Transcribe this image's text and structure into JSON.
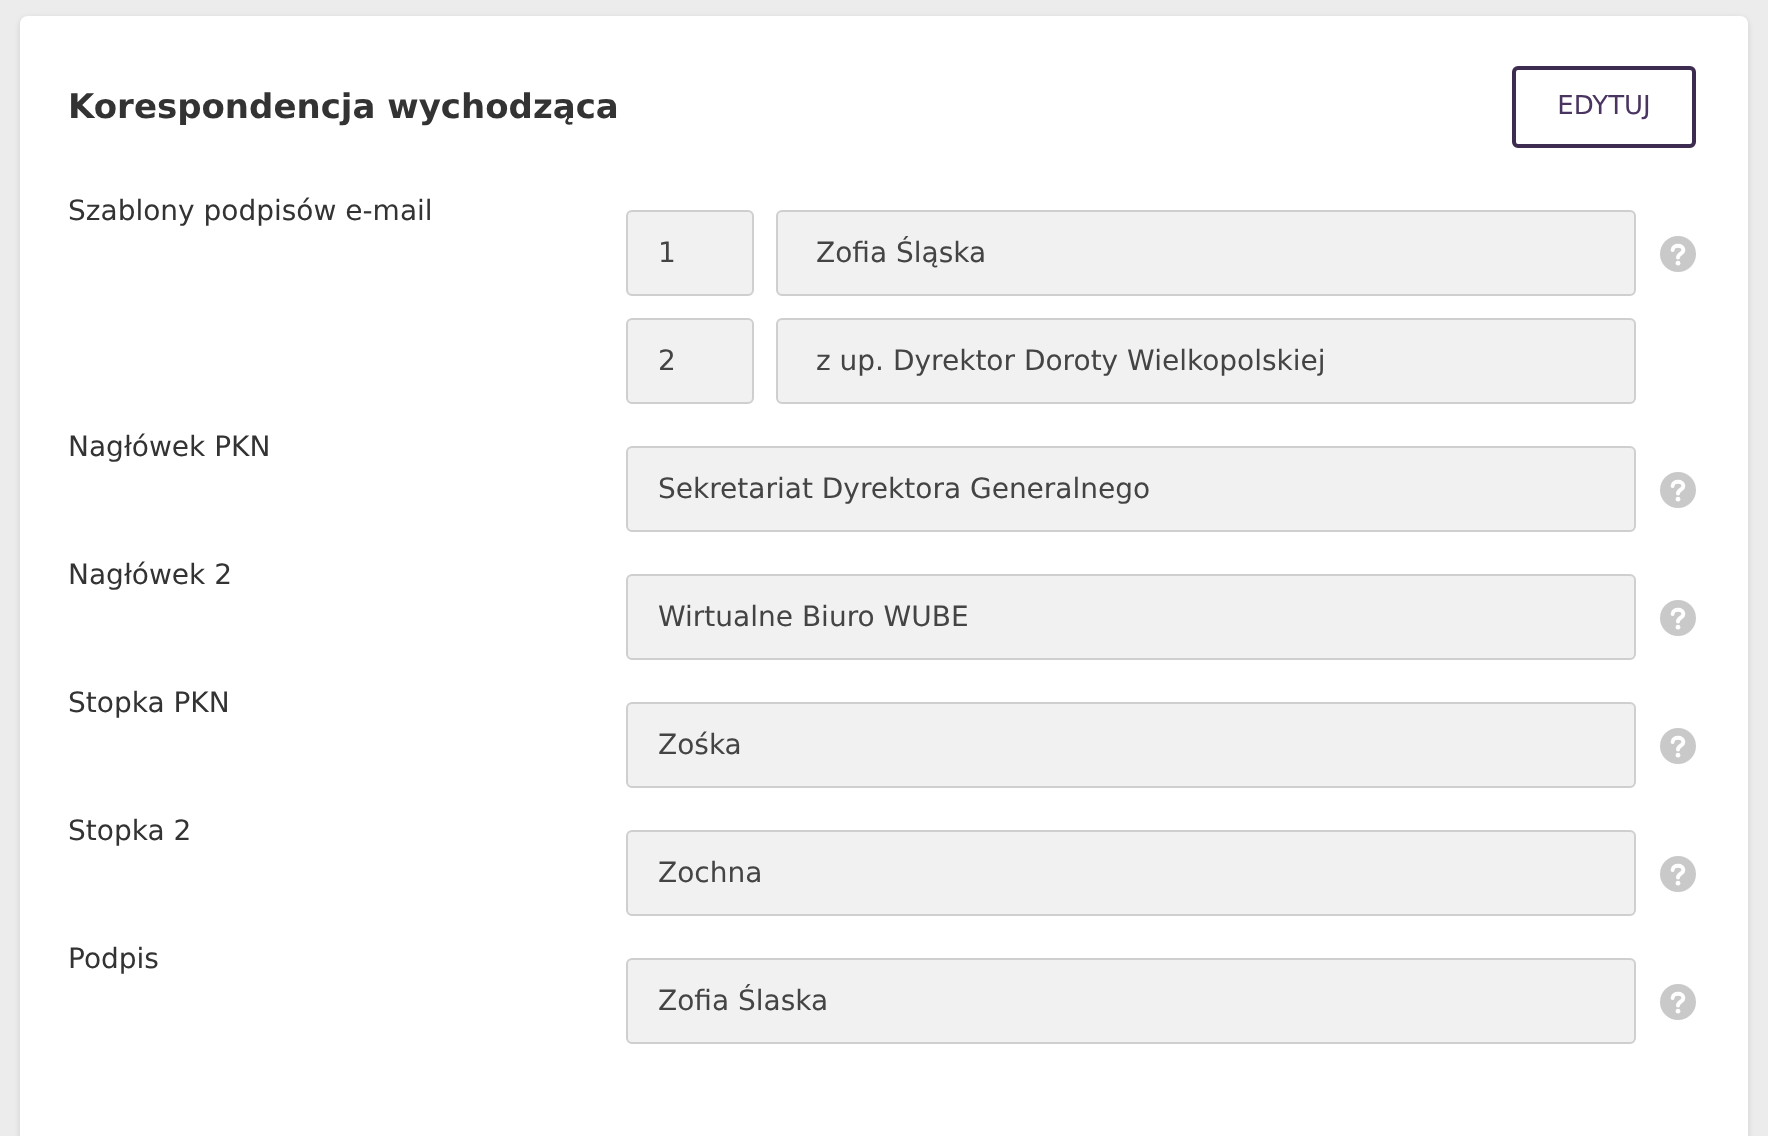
{
  "section": {
    "title": "Korespondencja wychodząca",
    "edit_button": "EDYTUJ",
    "fields": [
      {
        "label": "Szablony podpisów e-mail",
        "kind": "templates",
        "templates": [
          {
            "number": "1",
            "value": "Zofia Śląska",
            "help": true
          },
          {
            "number": "2",
            "value": "z up. Dyrektor Doroty Wielkopolskiej",
            "help": false
          }
        ]
      },
      {
        "label": "Nagłówek PKN",
        "kind": "text",
        "value": "Sekretariat Dyrektora Generalnego",
        "help": true
      },
      {
        "label": "Nagłówek 2",
        "kind": "text",
        "value": "Wirtualne Biuro WUBE",
        "help": true
      },
      {
        "label": "Stopka PKN",
        "kind": "text",
        "value": "Zośka",
        "help": true
      },
      {
        "label": "Stopka 2",
        "kind": "text",
        "value": "Zochna",
        "help": true
      },
      {
        "label": "Podpis",
        "kind": "text",
        "value": "Zofia Ślaska",
        "help": true
      }
    ]
  }
}
